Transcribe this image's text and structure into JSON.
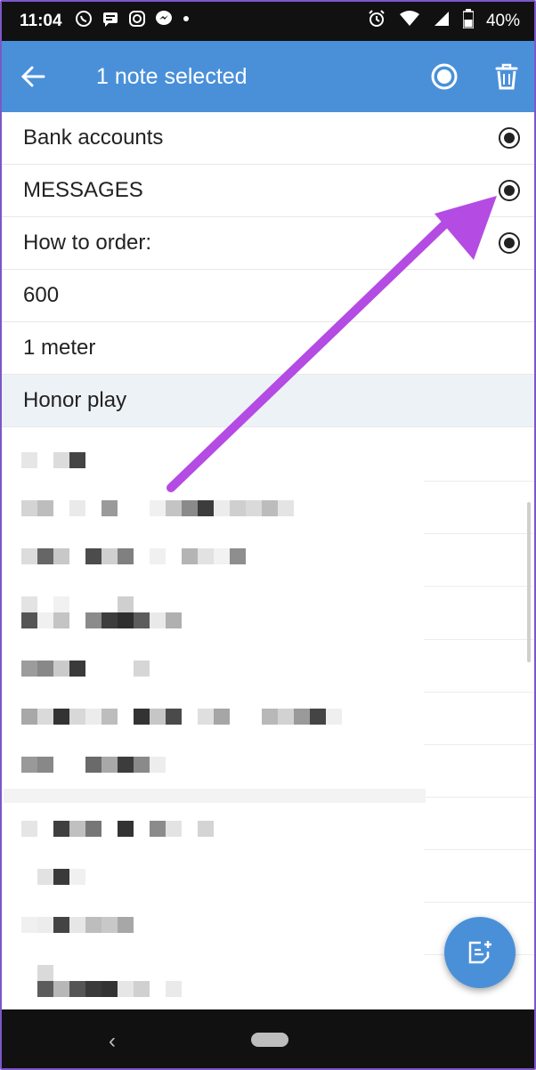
{
  "status_bar": {
    "time": "11:04",
    "battery": "40%",
    "icons": [
      "whatsapp-icon",
      "message-icon",
      "instagram-icon",
      "messenger-icon",
      "dot-icon",
      "alarm-icon",
      "wifi-icon",
      "signal-icon",
      "battery-icon"
    ]
  },
  "app_bar": {
    "title": "1 note selected",
    "back_icon": "arrow-back-icon",
    "select_all_icon": "radio-selected-icon",
    "delete_icon": "trash-icon",
    "color": "#4a90d9"
  },
  "notes": [
    {
      "label": "Bank accounts",
      "checked": true
    },
    {
      "label": "MESSAGES",
      "checked": true
    },
    {
      "label": "How to order:",
      "checked": true
    },
    {
      "label": "600",
      "checked": false
    },
    {
      "label": "1 meter",
      "checked": false
    },
    {
      "label": "Honor play",
      "checked": false,
      "selected": true
    }
  ],
  "fab": {
    "icon": "new-note-icon"
  },
  "annotation": {
    "color": "#b44be3"
  },
  "nav_bar": {
    "back_icon": "nav-back-icon",
    "home_icon": "nav-home-pill"
  }
}
